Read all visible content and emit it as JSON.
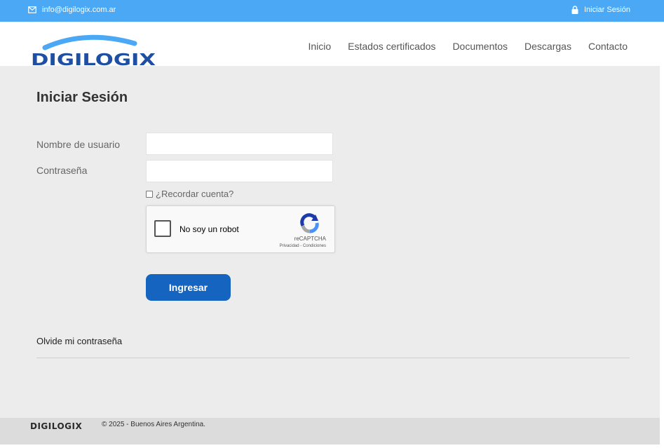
{
  "topbar": {
    "email": "info@digilogix.com.ar",
    "login_label": "Iniciar Sesión",
    "email_icon": "envelope-icon",
    "login_icon": "lock-icon"
  },
  "header": {
    "logo_text": "DIGILOGIX",
    "nav": [
      "Inicio",
      "Estados certificados",
      "Documentos",
      "Descargas",
      "Contacto"
    ]
  },
  "form": {
    "title": "Iniciar Sesión",
    "username_label": "Nombre de usuario",
    "username_value": "",
    "password_label": "Contraseña",
    "password_value": "",
    "remember_label": "¿Recordar cuenta?",
    "submit_label": "Ingresar",
    "forgot_label": "Olvide mi contraseña"
  },
  "captcha": {
    "text": "No soy un robot",
    "brand": "reCAPTCHA",
    "links": "Privacidad - Condiciones"
  },
  "footer": {
    "logo_text": "DIGILOGIX",
    "copyright": "© 2025 - Buenos Aires Argentina."
  },
  "colors": {
    "topbar": "#4aa8f5",
    "primary_button": "#1565c0",
    "background": "#ececec",
    "logo_dark": "#1f4fa3"
  }
}
